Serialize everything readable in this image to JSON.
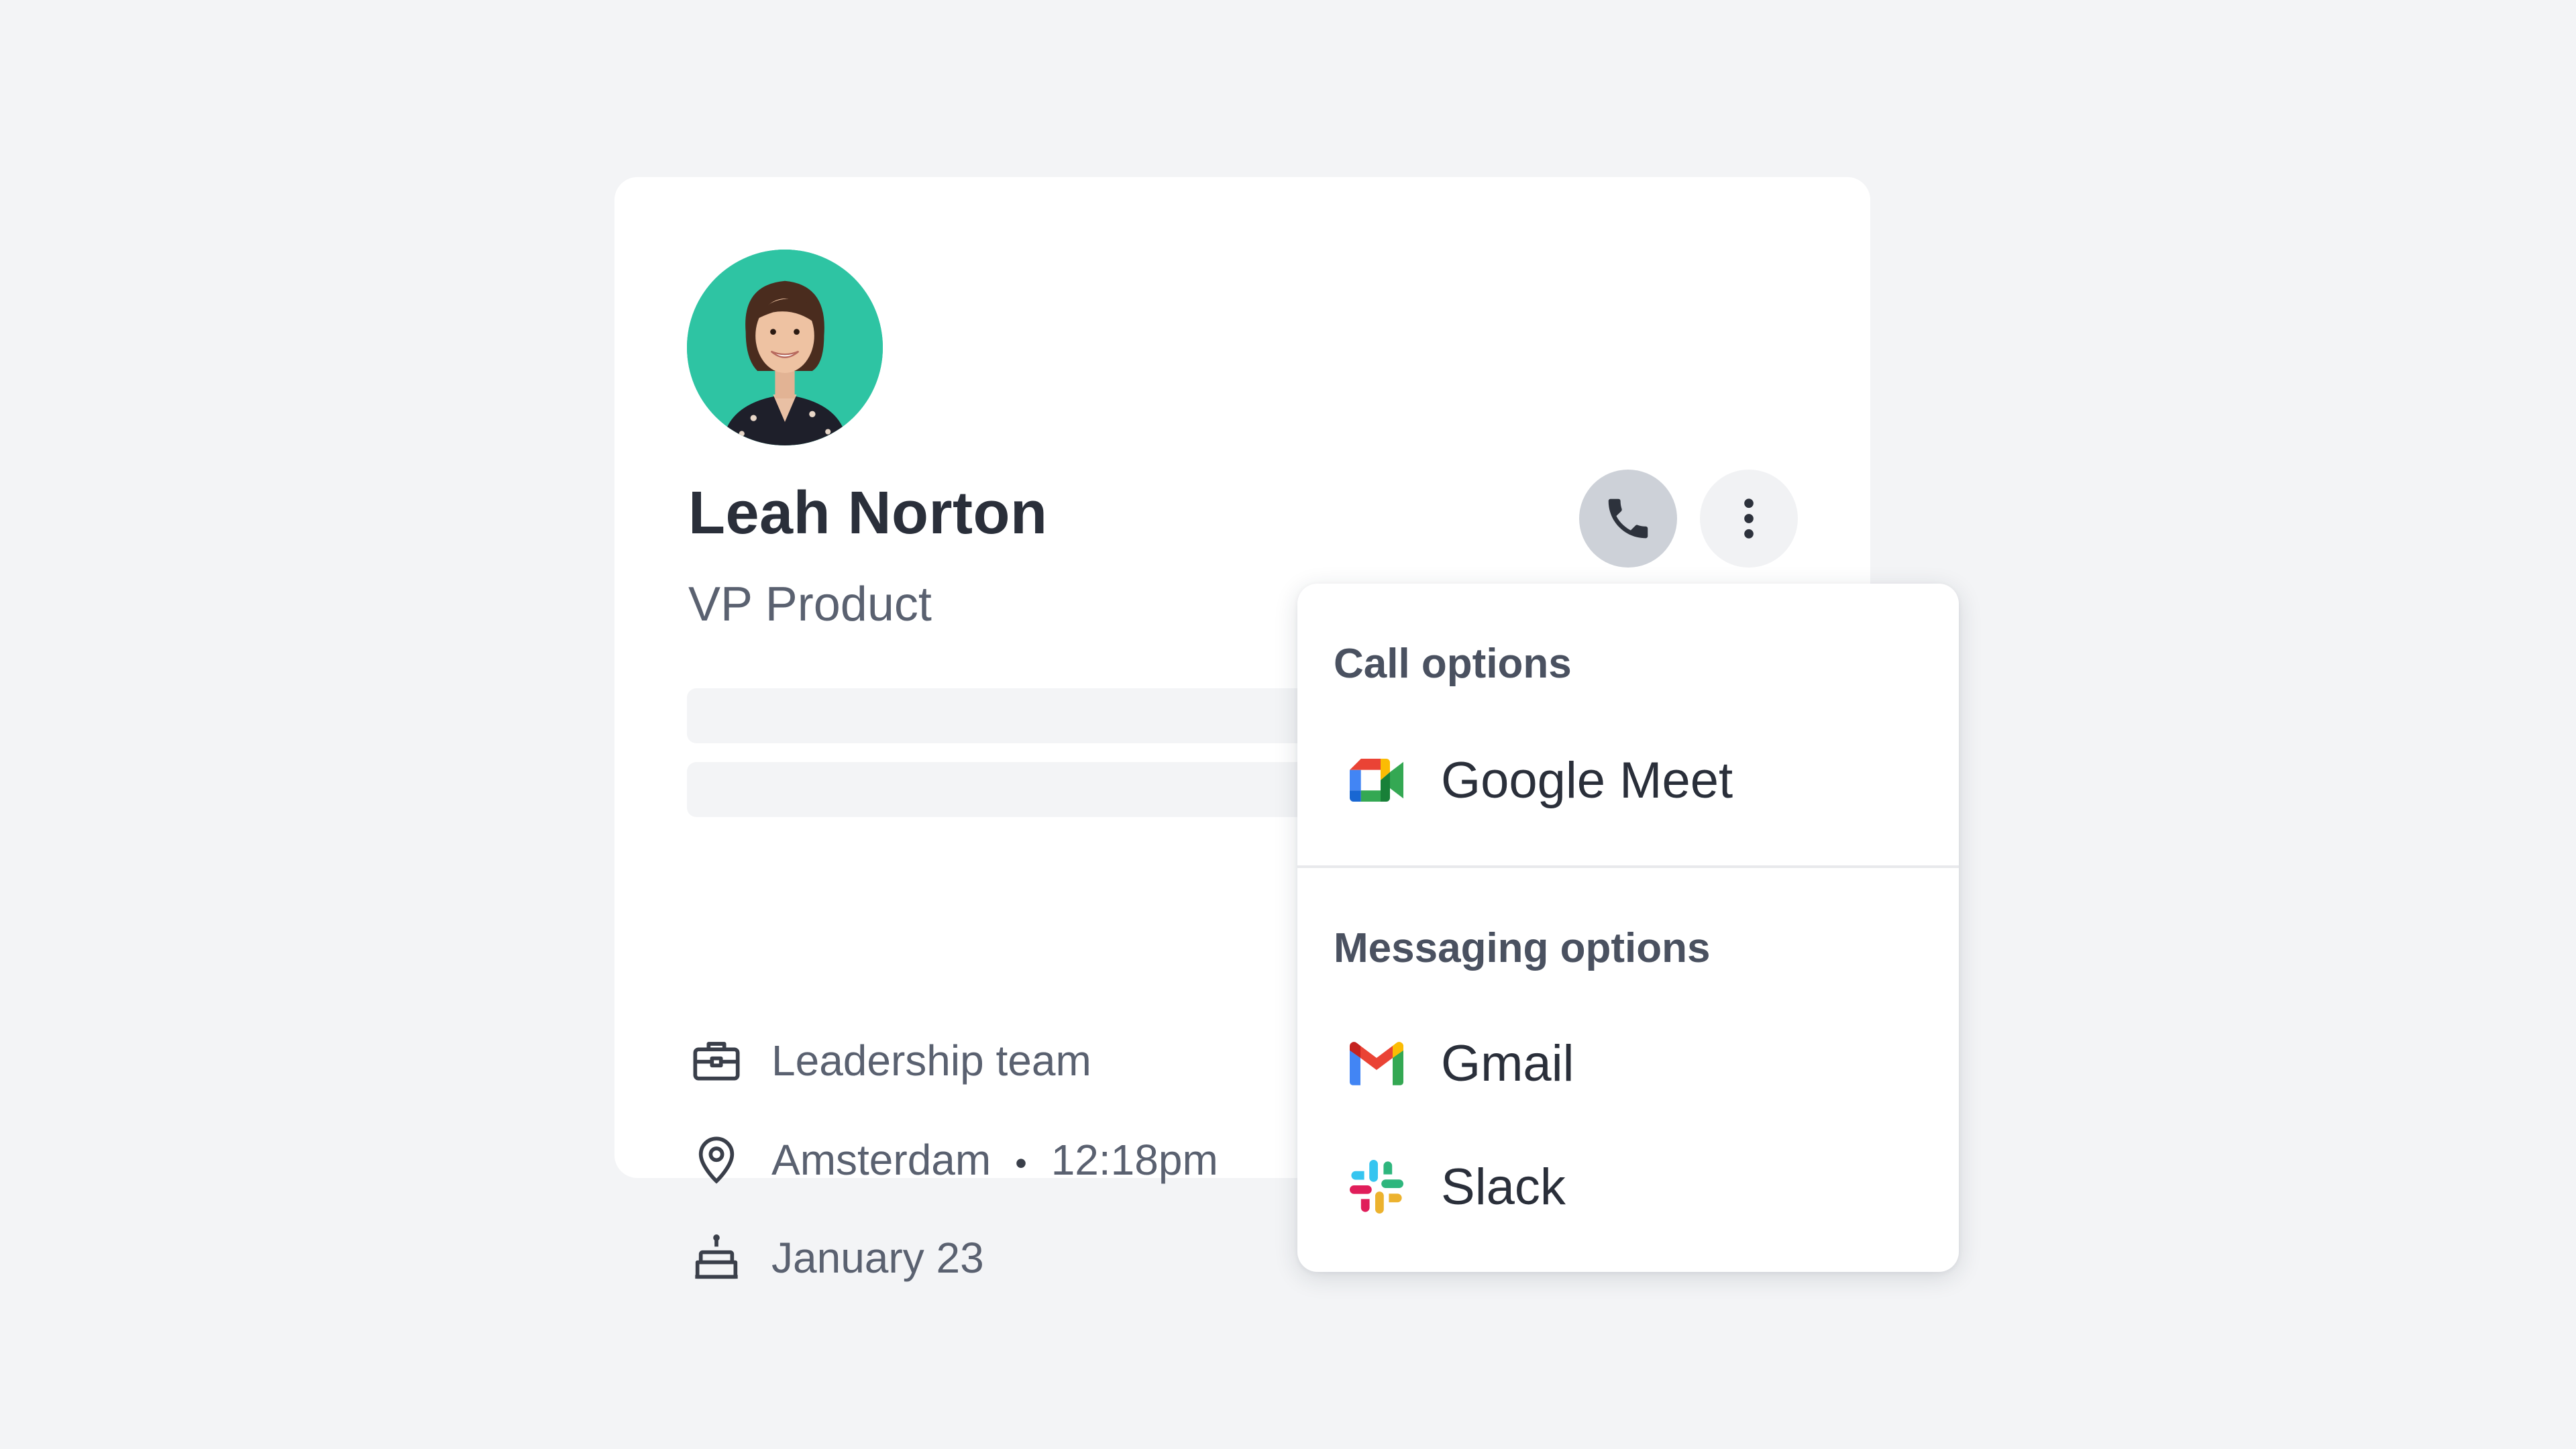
{
  "profile": {
    "name": "Leah Norton",
    "title": "VP Product",
    "team": "Leadership team",
    "location": "Amsterdam",
    "separator": "•",
    "local_time": "12:18pm",
    "birthday": "January 23"
  },
  "icons": {
    "team": "briefcase-icon",
    "location": "map-pin-icon",
    "birthday": "cake-icon",
    "call": "phone-icon",
    "more": "more-vertical-icon"
  },
  "dropdown": {
    "call_section_title": "Call options",
    "call_options": [
      {
        "label": "Google Meet",
        "icon": "google-meet-icon"
      }
    ],
    "messaging_section_title": "Messaging options",
    "messaging_options": [
      {
        "label": "Gmail",
        "icon": "gmail-icon"
      },
      {
        "label": "Slack",
        "icon": "slack-icon"
      }
    ]
  },
  "colors": {
    "background": "#f3f4f6",
    "card": "#ffffff",
    "avatar_bg": "#2ec4a3",
    "phone_button_active": "#cdd1d8",
    "more_button": "#f1f2f4",
    "text_primary": "#2a2f3a",
    "text_secondary": "#5a6170"
  }
}
